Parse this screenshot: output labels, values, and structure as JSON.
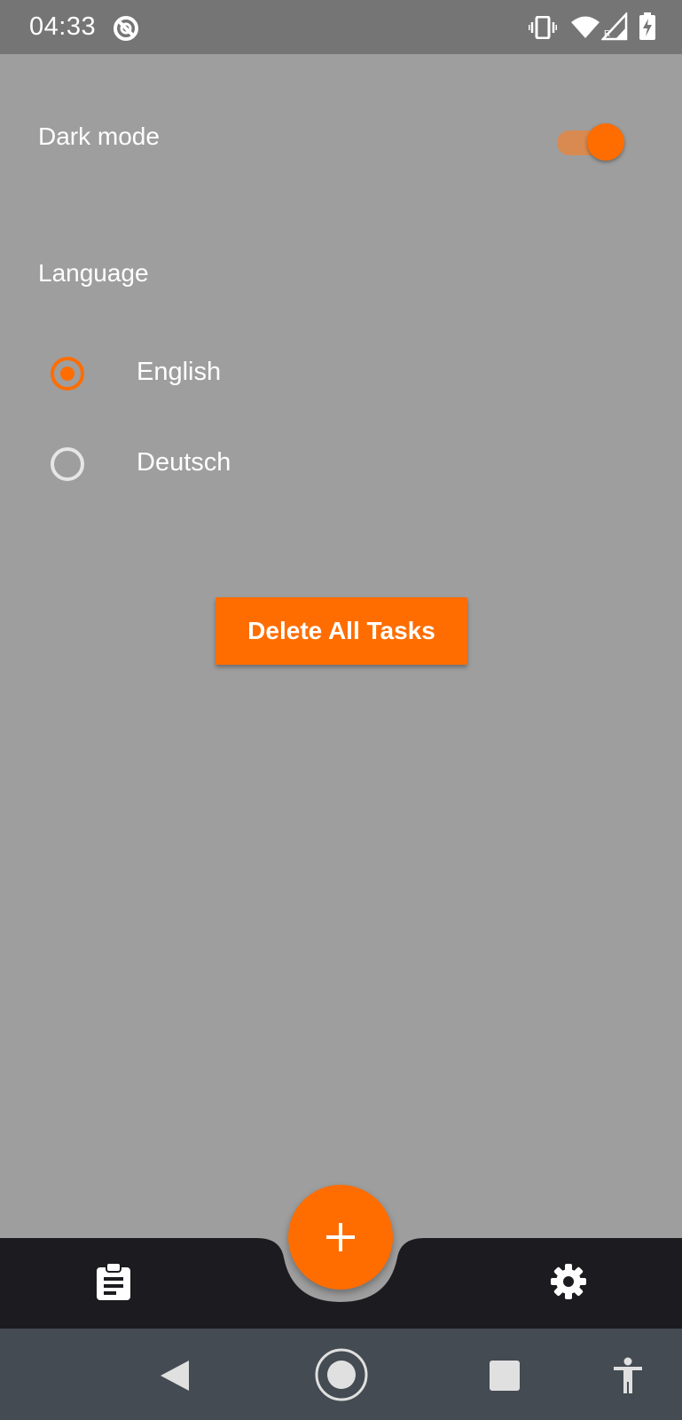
{
  "status_bar": {
    "time": "04:33",
    "icons": [
      "at-sign-icon",
      "vibrate-icon",
      "wifi-icon",
      "signal-icon",
      "battery-charging-icon"
    ]
  },
  "settings": {
    "dark_mode_label": "Dark mode",
    "dark_mode_on": true,
    "language_label": "Language",
    "languages": [
      {
        "label": "English",
        "selected": true
      },
      {
        "label": "Deutsch",
        "selected": false
      }
    ],
    "delete_button_label": "Delete All Tasks"
  },
  "bottom_bar": {
    "left_icon": "clipboard-list-icon",
    "right_icon": "settings-gear-icon",
    "fab_icon": "plus-icon"
  },
  "system_nav": {
    "icons": [
      "back-icon",
      "home-icon",
      "recents-icon",
      "accessibility-icon"
    ]
  },
  "colors": {
    "accent": "#ff6d00",
    "background": "#9e9e9e",
    "bottom_bar": "#1c1b1f",
    "status_bar": "#757575",
    "system_nav": "#444b52"
  }
}
